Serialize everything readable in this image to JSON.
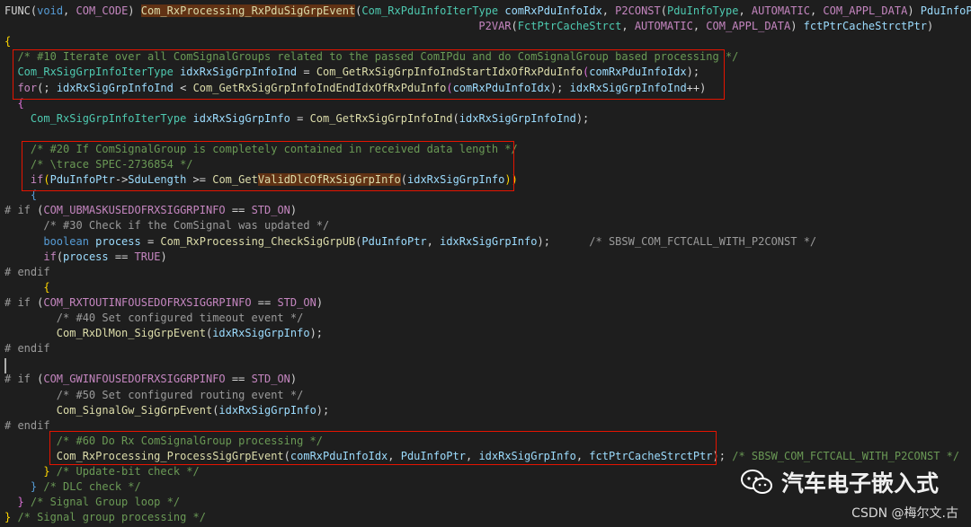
{
  "editor": {
    "lines": [
      [
        [
          "FUNC",
          "plain"
        ],
        [
          "(",
          "plain"
        ],
        [
          "void",
          "kw"
        ],
        [
          ", ",
          "plain"
        ],
        [
          "COM_CODE",
          "macro"
        ],
        [
          ") ",
          "plain"
        ],
        [
          "Com_RxProcessing_RxPduSigGrpEvent",
          "fn hl-orange"
        ],
        [
          "(",
          "plain"
        ],
        [
          "Com_RxPduInfoIterType",
          "type"
        ],
        [
          " comRxPduInfoIdx",
          "var"
        ],
        [
          ", ",
          "plain"
        ],
        [
          "P2CONST",
          "macro"
        ],
        [
          "(",
          "plain"
        ],
        [
          "PduInfoType",
          "type"
        ],
        [
          ", ",
          "plain"
        ],
        [
          "AUTOMATIC",
          "macro"
        ],
        [
          ", ",
          "plain"
        ],
        [
          "COM_APPL_DATA",
          "macro"
        ],
        [
          ") ",
          "plain"
        ],
        [
          "PduInfoPtr",
          "var"
        ],
        [
          ",",
          "plain"
        ]
      ],
      [
        [
          "                                                                         ",
          "plain"
        ],
        [
          "P2VAR",
          "macro"
        ],
        [
          "(",
          "plain"
        ],
        [
          "FctPtrCacheStrct",
          "type"
        ],
        [
          ", ",
          "plain"
        ],
        [
          "AUTOMATIC",
          "macro"
        ],
        [
          ", ",
          "plain"
        ],
        [
          "COM_APPL_DATA",
          "macro"
        ],
        [
          ") ",
          "plain"
        ],
        [
          "fctPtrCacheStrctPtr",
          "var"
        ],
        [
          ")",
          "plain"
        ]
      ],
      [
        [
          "{",
          "par"
        ]
      ],
      [
        [
          "  /* #10 Iterate over all ComSignalGroups related to the passed ComIPdu and do ComSignalGroup based processing */",
          "cmt"
        ]
      ],
      [
        [
          "  ",
          "plain"
        ],
        [
          "Com_RxSigGrpInfoIterType",
          "type"
        ],
        [
          " idxRxSigGrpInfoInd",
          "var"
        ],
        [
          " = ",
          "plain"
        ],
        [
          "Com_GetRxSigGrpInfoIndStartIdxOfRxPduInfo",
          "fn"
        ],
        [
          "(",
          "par2"
        ],
        [
          "comRxPduInfoIdx",
          "var"
        ],
        [
          ");",
          "plain"
        ]
      ],
      [
        [
          "  ",
          "plain"
        ],
        [
          "for",
          "macro"
        ],
        [
          "(; ",
          "plain"
        ],
        [
          "idxRxSigGrpInfoInd",
          "var"
        ],
        [
          " < ",
          "plain"
        ],
        [
          "Com_GetRxSigGrpInfoIndEndIdxOfRxPduInfo",
          "fn"
        ],
        [
          "(",
          "par2"
        ],
        [
          "comRxPduInfoIdx",
          "var"
        ],
        [
          "); ",
          "plain"
        ],
        [
          "idxRxSigGrpInfoInd",
          "var"
        ],
        [
          "++)",
          "plain"
        ]
      ],
      [
        [
          "  {",
          "par2"
        ]
      ],
      [
        [
          "    ",
          "plain"
        ],
        [
          "Com_RxSigGrpInfoIterType",
          "type"
        ],
        [
          " idxRxSigGrpInfo",
          "var"
        ],
        [
          " = ",
          "plain"
        ],
        [
          "Com_GetRxSigGrpInfoInd",
          "fn"
        ],
        [
          "(",
          "plain"
        ],
        [
          "idxRxSigGrpInfoInd",
          "var"
        ],
        [
          ");",
          "plain"
        ]
      ],
      [
        [
          "",
          "plain"
        ]
      ],
      [
        [
          "    /* #20 If ComSignalGroup is completely contained in received data length */",
          "cmt"
        ]
      ],
      [
        [
          "    /* \\trace SPEC-2736854 */",
          "cmt"
        ]
      ],
      [
        [
          "    ",
          "plain"
        ],
        [
          "if",
          "macro"
        ],
        [
          "(",
          "par"
        ],
        [
          "PduInfoPtr",
          "var"
        ],
        [
          "->",
          "plain"
        ],
        [
          "SduLength",
          "var"
        ],
        [
          " >= ",
          "plain"
        ],
        [
          "Com_Get",
          "fn"
        ],
        [
          "ValidDlcOfRxSigGrpInfo",
          "fn hl-orange"
        ],
        [
          "(",
          "plain"
        ],
        [
          "idxRxSigGrpInfo",
          "var"
        ],
        [
          "))",
          "par"
        ]
      ],
      [
        [
          "    {",
          "kw"
        ]
      ],
      [
        [
          "# if ",
          "pre"
        ],
        [
          "(",
          "plain"
        ],
        [
          "COM_UBMASKUSEDOFRXSIGGRPINFO",
          "macro"
        ],
        [
          " == ",
          "plain"
        ],
        [
          "STD_ON",
          "macro"
        ],
        [
          ")",
          "plain"
        ]
      ],
      [
        [
          "      /* #30 Check if the ComSignal was updated */",
          "pre"
        ]
      ],
      [
        [
          "      ",
          "plain"
        ],
        [
          "boolean",
          "kw"
        ],
        [
          " process",
          "var"
        ],
        [
          " = ",
          "plain"
        ],
        [
          "Com_RxProcessing_CheckSigGrpUB",
          "fn"
        ],
        [
          "(",
          "plain"
        ],
        [
          "PduInfoPtr",
          "var"
        ],
        [
          ", ",
          "plain"
        ],
        [
          "idxRxSigGrpInfo",
          "var"
        ],
        [
          ");      ",
          "plain"
        ],
        [
          "/* SBSW_COM_FCTCALL_WITH_P2CONST */",
          "pre"
        ]
      ],
      [
        [
          "      ",
          "plain"
        ],
        [
          "if",
          "macro"
        ],
        [
          "(",
          "plain"
        ],
        [
          "process",
          "var"
        ],
        [
          " == ",
          "plain"
        ],
        [
          "TRUE",
          "macro"
        ],
        [
          ")",
          "plain"
        ]
      ],
      [
        [
          "# endif",
          "pre"
        ]
      ],
      [
        [
          "      {",
          "par"
        ]
      ],
      [
        [
          "# if ",
          "pre"
        ],
        [
          "(",
          "plain"
        ],
        [
          "COM_RXTOUTINFOUSEDOFRXSIGGRPINFO",
          "macro"
        ],
        [
          " == ",
          "plain"
        ],
        [
          "STD_ON",
          "macro"
        ],
        [
          ")",
          "plain"
        ]
      ],
      [
        [
          "        /* #40 Set configured timeout event */",
          "pre"
        ]
      ],
      [
        [
          "        ",
          "plain"
        ],
        [
          "Com_RxDlMon_SigGrpEvent",
          "fn"
        ],
        [
          "(",
          "plain"
        ],
        [
          "idxRxSigGrpInfo",
          "var"
        ],
        [
          ");",
          "plain"
        ]
      ],
      [
        [
          "# endif",
          "pre"
        ]
      ],
      [
        [
          "",
          "plain"
        ]
      ],
      [
        [
          "# if ",
          "pre"
        ],
        [
          "(",
          "plain"
        ],
        [
          "COM_GWINFOUSEDOFRXSIGGRPINFO",
          "macro"
        ],
        [
          " == ",
          "plain"
        ],
        [
          "STD_ON",
          "macro"
        ],
        [
          ")",
          "plain"
        ]
      ],
      [
        [
          "        /* #50 Set configured routing event */",
          "pre"
        ]
      ],
      [
        [
          "        ",
          "plain"
        ],
        [
          "Com_SignalGw_SigGrpEvent",
          "fn"
        ],
        [
          "(",
          "plain"
        ],
        [
          "idxRxSigGrpInfo",
          "var"
        ],
        [
          ");",
          "plain"
        ]
      ],
      [
        [
          "# endif",
          "pre"
        ]
      ],
      [
        [
          "        /* #60 Do Rx ComSignalGroup processing */",
          "cmt"
        ]
      ],
      [
        [
          "        ",
          "plain"
        ],
        [
          "Com_RxProcessing_ProcessSigGrpEvent",
          "fn"
        ],
        [
          "(",
          "plain"
        ],
        [
          "comRxPduInfoIdx",
          "var"
        ],
        [
          ", ",
          "plain"
        ],
        [
          "PduInfoPtr",
          "var"
        ],
        [
          ", ",
          "plain"
        ],
        [
          "idxRxSigGrpInfo",
          "var"
        ],
        [
          ", ",
          "plain"
        ],
        [
          "fctPtrCacheStrctPtr",
          "var"
        ],
        [
          ");",
          "plain"
        ],
        [
          " /* SBSW_COM_FCTCALL_WITH_P2CONST */",
          "cmt"
        ]
      ],
      [
        [
          "      }",
          "par"
        ],
        [
          " /* Update-bit check */",
          "cmt"
        ]
      ],
      [
        [
          "    }",
          "kw"
        ],
        [
          " /* DLC check */",
          "cmt"
        ]
      ],
      [
        [
          "  }",
          "par2"
        ],
        [
          " /* Signal Group loop */",
          "cmt"
        ]
      ],
      [
        [
          "}",
          "par"
        ],
        [
          " /* Signal group processing */",
          "cmt"
        ]
      ]
    ]
  },
  "watermark": {
    "logo_icon": "wechat-icon",
    "text": "汽车电子嵌入式"
  },
  "footer": {
    "source": "CSDN @梅尔文.古"
  }
}
